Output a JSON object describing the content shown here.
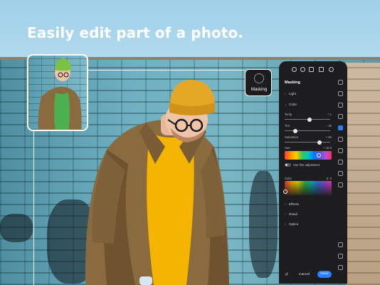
{
  "headline": "Easily edit part of a photo.",
  "masking_badge": {
    "label": "Masking"
  },
  "panel": {
    "title": "Masking",
    "toolbar_icons": [
      "undo-icon",
      "info-icon",
      "compare-icon",
      "share-icon",
      "cloud-icon"
    ],
    "sections": {
      "light": "Light",
      "color": "Color",
      "effects": "Effects",
      "detail": "Detail",
      "optics": "Optics"
    },
    "sliders": [
      {
        "label": "Temp",
        "value": "+ 1",
        "position": 0.55
      },
      {
        "label": "Tint",
        "value": "- 45",
        "position": 0.2
      },
      {
        "label": "Saturation",
        "value": "+ 62",
        "position": 0.8
      }
    ],
    "hue": {
      "label": "Hue",
      "value": "+ 10.3"
    },
    "fine_adjustment": "Use fine adjustment",
    "color_picker": {
      "label": "Color",
      "value": "S: 0"
    },
    "footer": {
      "cancel": "Cancel",
      "done": "Done"
    }
  },
  "colors": {
    "accent": "#2b7fff",
    "panel_bg": "#1d1d1f",
    "beanie": "#e5a826",
    "jacket": "#8a6a3f",
    "sweater": "#f5b400"
  }
}
